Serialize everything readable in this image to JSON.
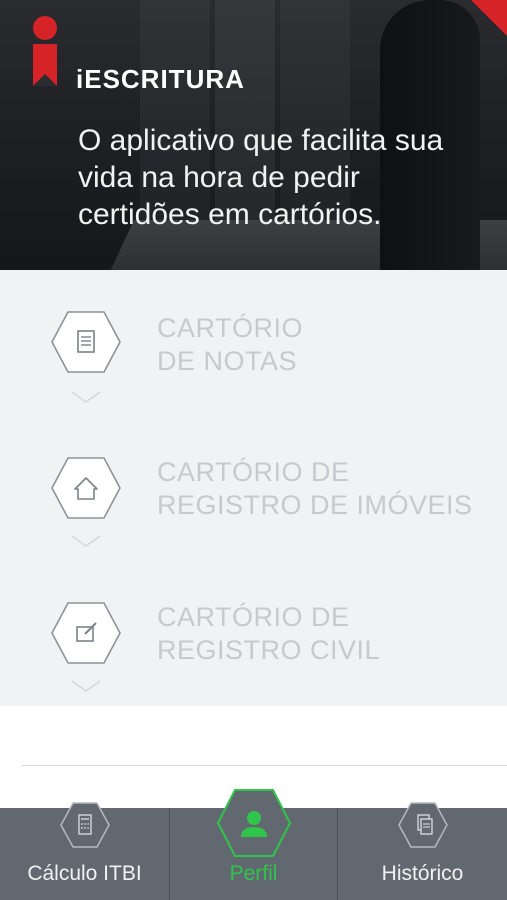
{
  "colors": {
    "accent_red": "#d62328",
    "accent_green": "#2fc44a",
    "list_bg": "#f1f2f4",
    "item_text": "#c6c9cd",
    "tabbar_bg": "#626870"
  },
  "header": {
    "brand": "iESCRITURA",
    "tagline": "O aplicativo que facilita sua vida na hora de pedir certidões em cartórios."
  },
  "services": [
    {
      "label": "CARTÓRIO\nDE NOTAS",
      "icon": "document-icon"
    },
    {
      "label": "CARTÓRIO DE\nREGISTRO DE IMÓVEIS",
      "icon": "house-icon"
    },
    {
      "label": "CARTÓRIO DE\nREGISTRO CIVIL",
      "icon": "edit-icon"
    }
  ],
  "tabs": [
    {
      "label": "Cálculo ITBI",
      "icon": "calculator-icon",
      "active": false
    },
    {
      "label": "Perfil",
      "icon": "user-icon",
      "active": true
    },
    {
      "label": "Histórico",
      "icon": "documents-icon",
      "active": false
    }
  ]
}
